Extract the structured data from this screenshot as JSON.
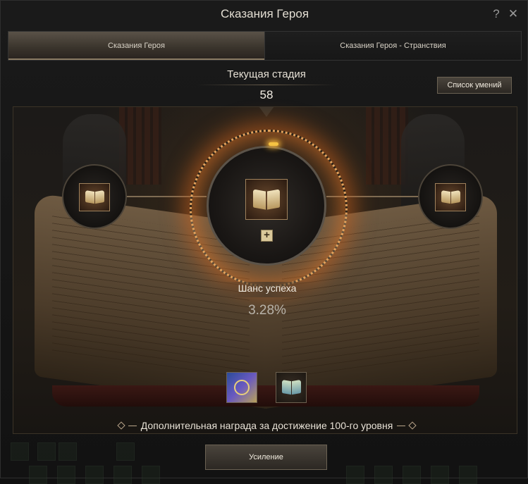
{
  "window": {
    "title": "Сказания Героя",
    "help_glyph": "?",
    "close_glyph": "✕"
  },
  "tabs": [
    {
      "label": "Сказания Героя",
      "active": true
    },
    {
      "label": "Сказания Героя - Странствия",
      "active": false
    }
  ],
  "stage": {
    "label": "Текущая стадия",
    "value": "58"
  },
  "skills_button": "Список умений",
  "slots": {
    "left_icon": "book-icon",
    "center_icon": "book-icon",
    "right_icon": "book-icon",
    "add_glyph": "+"
  },
  "success": {
    "label": "Шанс успеха",
    "value": "3.28%"
  },
  "rewards": {
    "items": [
      "enchant-scroll-icon",
      "skill-book-icon"
    ],
    "bonus_text": "Дополнительная награда за достижение 100-го уровня"
  },
  "enhance_button": "Усиление",
  "colors": {
    "accent_orange": "#e2a25c",
    "spark_gold": "#f5c343",
    "frame_brown": "#a0825c"
  }
}
